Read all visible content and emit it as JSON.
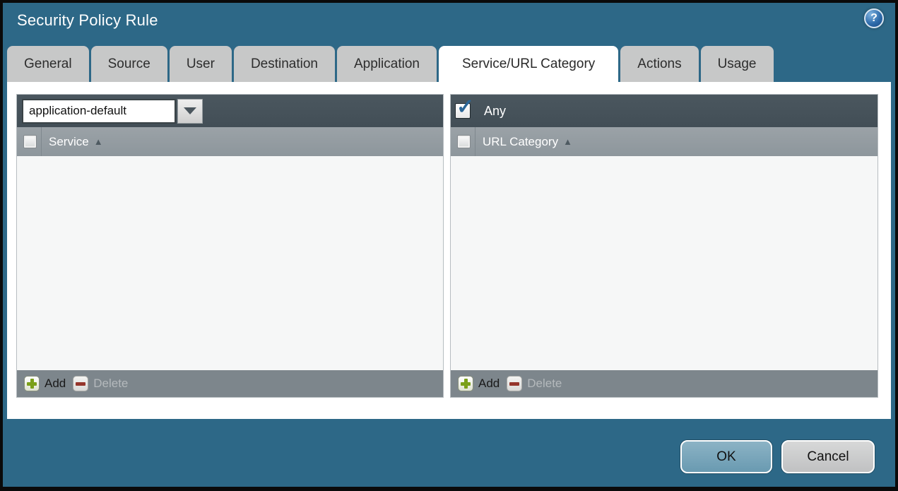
{
  "window": {
    "title": "Security Policy Rule"
  },
  "help": {
    "icon": "?"
  },
  "tabs": [
    {
      "label": "General",
      "active": false
    },
    {
      "label": "Source",
      "active": false
    },
    {
      "label": "User",
      "active": false
    },
    {
      "label": "Destination",
      "active": false
    },
    {
      "label": "Application",
      "active": false
    },
    {
      "label": "Service/URL Category",
      "active": true
    },
    {
      "label": "Actions",
      "active": false
    },
    {
      "label": "Usage",
      "active": false
    }
  ],
  "service_panel": {
    "dropdown": {
      "value": "application-default"
    },
    "column_header": "Service",
    "select_all_checked": false,
    "rows": [],
    "add_label": "Add",
    "delete_label": "Delete",
    "delete_enabled": false
  },
  "url_category_panel": {
    "any_label": "Any",
    "any_checked": true,
    "column_header": "URL Category",
    "select_all_checked": false,
    "rows": [],
    "add_label": "Add",
    "delete_label": "Delete",
    "delete_enabled": false
  },
  "dialog_buttons": {
    "ok": "OK",
    "cancel": "Cancel"
  },
  "icons": {
    "checkmark": "✓",
    "sort_asc": "▲"
  },
  "colors": {
    "background_teal": "#2d6887",
    "panel_header_bg": "#46525a",
    "column_header_bg": "#939ba1",
    "panel_footer_bg": "#7d868c",
    "tab_inactive_bg": "#c7c8c8",
    "tab_active_bg": "#ffffff",
    "body_bg": "#f6f7f7",
    "ok_button_bg": "#7ba7bd",
    "cancel_button_bg": "#c9cacb",
    "add_icon_green": "#7ba019",
    "delete_icon_red": "#95352b",
    "check_blue": "#2b6697"
  }
}
